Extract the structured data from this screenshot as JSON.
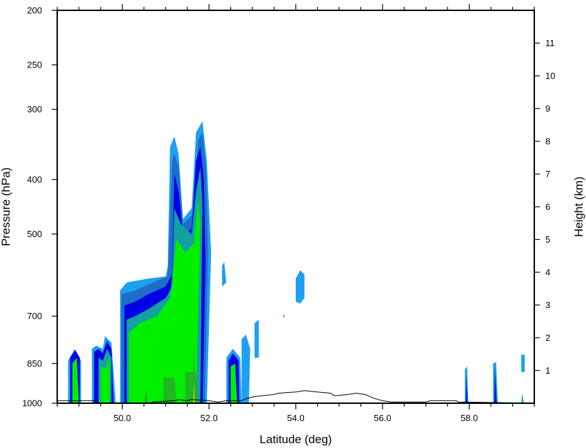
{
  "chart_data": {
    "type": "heatmap",
    "title": "",
    "xlabel": "Latitude (deg)",
    "ylabel": "Pressure (hPa)",
    "y2label": "Height (km)",
    "xlim": [
      48.5,
      59.5
    ],
    "ylim": [
      1000,
      200
    ],
    "y_scale": "log",
    "y2lim": [
      0,
      12
    ],
    "x_ticks": [
      50,
      52,
      54,
      56,
      58
    ],
    "x_tick_labels": [
      "50.0",
      "52.0",
      "54.0",
      "56.0",
      "58.0"
    ],
    "y_ticks": [
      200,
      250,
      300,
      400,
      500,
      700,
      850,
      1000
    ],
    "y_tick_labels": [
      "200",
      "250",
      "300",
      "400",
      "500",
      "700",
      "850",
      "1000"
    ],
    "y2_ticks": [
      1,
      2,
      3,
      4,
      5,
      6,
      7,
      8,
      9,
      10,
      11
    ],
    "y2_tick_labels": [
      "1",
      "2",
      "3",
      "4",
      "5",
      "6",
      "7",
      "8",
      "9",
      "10",
      "11"
    ],
    "grid": false,
    "colors": {
      "level1": "#1ea0f0",
      "level2": "#1e6ec8",
      "level3": "#0000e6",
      "level4": "#14a0a0",
      "level5": "#00f000",
      "level6": "#22b422",
      "level7": "#dcdc28"
    },
    "regions": [
      {
        "level": 1,
        "points": [
          [
            48.75,
            1000
          ],
          [
            48.75,
            840
          ],
          [
            48.9,
            800
          ],
          [
            49.05,
            840
          ],
          [
            49.05,
            1000
          ]
        ]
      },
      {
        "level": 3,
        "points": [
          [
            48.8,
            1000
          ],
          [
            48.8,
            830
          ],
          [
            48.92,
            805
          ],
          [
            49.02,
            830
          ],
          [
            49.02,
            1000
          ]
        ]
      },
      {
        "level": 5,
        "points": [
          [
            48.85,
            1000
          ],
          [
            48.85,
            850
          ],
          [
            48.95,
            830
          ],
          [
            49.0,
            1000
          ]
        ]
      },
      {
        "level": 1,
        "points": [
          [
            49.3,
            1000
          ],
          [
            49.3,
            800
          ],
          [
            49.4,
            790
          ],
          [
            49.55,
            800
          ],
          [
            49.6,
            760
          ],
          [
            49.75,
            780
          ],
          [
            49.85,
            1000
          ]
        ]
      },
      {
        "level": 3,
        "points": [
          [
            49.35,
            1000
          ],
          [
            49.35,
            810
          ],
          [
            49.45,
            800
          ],
          [
            49.55,
            815
          ],
          [
            49.65,
            775
          ],
          [
            49.75,
            800
          ],
          [
            49.8,
            1000
          ]
        ]
      },
      {
        "level": 4,
        "points": [
          [
            49.45,
            1000
          ],
          [
            49.45,
            830
          ],
          [
            49.55,
            840
          ],
          [
            49.65,
            800
          ],
          [
            49.75,
            830
          ],
          [
            49.75,
            1000
          ]
        ]
      },
      {
        "level": 5,
        "points": [
          [
            49.5,
            1000
          ],
          [
            49.5,
            860
          ],
          [
            49.6,
            870
          ],
          [
            49.7,
            830
          ],
          [
            49.72,
            1000
          ]
        ]
      },
      {
        "level": 1,
        "points": [
          [
            49.95,
            1000
          ],
          [
            49.95,
            630
          ],
          [
            50.1,
            610
          ],
          [
            50.6,
            600
          ],
          [
            51.0,
            595
          ],
          [
            51.05,
            570
          ],
          [
            51.1,
            350
          ],
          [
            51.2,
            335
          ],
          [
            51.3,
            360
          ],
          [
            51.4,
            470
          ],
          [
            51.6,
            450
          ],
          [
            51.7,
            330
          ],
          [
            51.85,
            315
          ],
          [
            51.95,
            370
          ],
          [
            52.05,
            540
          ],
          [
            51.95,
            1000
          ]
        ]
      },
      {
        "level": 2,
        "points": [
          [
            49.98,
            1000
          ],
          [
            49.98,
            640
          ],
          [
            50.3,
            630
          ],
          [
            50.7,
            610
          ],
          [
            51.05,
            595
          ],
          [
            51.15,
            370
          ],
          [
            51.2,
            360
          ],
          [
            51.3,
            380
          ],
          [
            51.4,
            480
          ],
          [
            51.65,
            460
          ],
          [
            51.75,
            340
          ],
          [
            51.85,
            330
          ],
          [
            51.93,
            380
          ],
          [
            51.98,
            540
          ],
          [
            51.9,
            1000
          ]
        ]
      },
      {
        "level": 3,
        "points": [
          [
            50.05,
            1000
          ],
          [
            50.05,
            670
          ],
          [
            50.3,
            660
          ],
          [
            50.6,
            640
          ],
          [
            51.0,
            620
          ],
          [
            51.15,
            590
          ],
          [
            51.2,
            390
          ],
          [
            51.3,
            420
          ],
          [
            51.4,
            500
          ],
          [
            51.6,
            490
          ],
          [
            51.7,
            370
          ],
          [
            51.8,
            350
          ],
          [
            51.88,
            400
          ],
          [
            51.92,
            560
          ],
          [
            51.85,
            1000
          ]
        ]
      },
      {
        "level": 4,
        "points": [
          [
            50.1,
            1000
          ],
          [
            50.1,
            710
          ],
          [
            50.3,
            700
          ],
          [
            50.6,
            680
          ],
          [
            51.0,
            650
          ],
          [
            51.15,
            620
          ],
          [
            51.2,
            450
          ],
          [
            51.35,
            480
          ],
          [
            51.6,
            500
          ],
          [
            51.7,
            420
          ],
          [
            51.8,
            380
          ],
          [
            51.85,
            440
          ],
          [
            51.8,
            1000
          ]
        ]
      },
      {
        "level": 5,
        "points": [
          [
            50.15,
            1000
          ],
          [
            50.15,
            750
          ],
          [
            50.4,
            720
          ],
          [
            50.8,
            700
          ],
          [
            51.1,
            650
          ],
          [
            51.25,
            510
          ],
          [
            51.45,
            540
          ],
          [
            51.65,
            520
          ],
          [
            51.75,
            430
          ],
          [
            51.8,
            480
          ],
          [
            51.78,
            580
          ],
          [
            51.7,
            1000
          ]
        ]
      },
      {
        "level": 6,
        "points": [
          [
            50.5,
            1000
          ],
          [
            50.55,
            950
          ],
          [
            50.6,
            1000
          ]
        ]
      },
      {
        "level": 6,
        "points": [
          [
            50.95,
            1000
          ],
          [
            50.95,
            900
          ],
          [
            51.2,
            900
          ],
          [
            51.25,
            1000
          ]
        ]
      },
      {
        "level": 6,
        "points": [
          [
            51.45,
            1000
          ],
          [
            51.45,
            880
          ],
          [
            51.7,
            880
          ],
          [
            51.75,
            1000
          ]
        ]
      },
      {
        "level": 6,
        "points": [
          [
            51.62,
            1000
          ],
          [
            51.65,
            760
          ],
          [
            51.68,
            1000
          ]
        ]
      },
      {
        "level": 7,
        "points": [
          [
            51.64,
            1000
          ],
          [
            51.65,
            910
          ],
          [
            51.67,
            1000
          ]
        ]
      },
      {
        "level": 1,
        "points": [
          [
            52.4,
            1000
          ],
          [
            52.4,
            830
          ],
          [
            52.55,
            800
          ],
          [
            52.72,
            830
          ],
          [
            52.75,
            1000
          ]
        ]
      },
      {
        "level": 3,
        "points": [
          [
            52.45,
            1000
          ],
          [
            52.45,
            840
          ],
          [
            52.55,
            815
          ],
          [
            52.68,
            840
          ],
          [
            52.7,
            1000
          ]
        ]
      },
      {
        "level": 5,
        "points": [
          [
            52.5,
            1000
          ],
          [
            52.5,
            860
          ],
          [
            52.6,
            850
          ],
          [
            52.65,
            1000
          ]
        ]
      },
      {
        "level": 1,
        "points": [
          [
            52.75,
            1000
          ],
          [
            52.75,
            770
          ],
          [
            52.85,
            755
          ],
          [
            52.95,
            800
          ],
          [
            52.92,
            1000
          ]
        ]
      },
      {
        "level": 1,
        "points": [
          [
            53.05,
            830
          ],
          [
            53.05,
            720
          ],
          [
            53.15,
            710
          ],
          [
            53.15,
            830
          ]
        ]
      },
      {
        "level": 1,
        "points": [
          [
            53.7,
            695
          ],
          [
            53.75,
            700
          ],
          [
            53.72,
            705
          ]
        ]
      },
      {
        "level": 1,
        "points": [
          [
            54.0,
            660
          ],
          [
            54.0,
            600
          ],
          [
            54.1,
            580
          ],
          [
            54.2,
            590
          ],
          [
            54.2,
            650
          ],
          [
            54.1,
            665
          ]
        ]
      },
      {
        "level": 1,
        "points": [
          [
            52.3,
            620
          ],
          [
            52.3,
            570
          ],
          [
            52.35,
            560
          ],
          [
            52.4,
            610
          ]
        ]
      },
      {
        "level": 1,
        "points": [
          [
            57.9,
            1000
          ],
          [
            57.9,
            870
          ],
          [
            57.95,
            860
          ],
          [
            57.98,
            1000
          ]
        ]
      },
      {
        "level": 3,
        "points": [
          [
            57.92,
            1000
          ],
          [
            57.93,
            890
          ],
          [
            57.96,
            1000
          ]
        ]
      },
      {
        "level": 1,
        "points": [
          [
            58.55,
            1000
          ],
          [
            58.55,
            850
          ],
          [
            58.62,
            845
          ],
          [
            58.66,
            1000
          ]
        ]
      },
      {
        "level": 3,
        "points": [
          [
            58.58,
            1000
          ],
          [
            58.59,
            860
          ],
          [
            58.63,
            1000
          ]
        ]
      },
      {
        "level": 1,
        "points": [
          [
            59.2,
            880
          ],
          [
            59.2,
            820
          ],
          [
            59.28,
            820
          ],
          [
            59.28,
            880
          ]
        ]
      },
      {
        "level": 1,
        "points": [
          [
            59.2,
            1000
          ],
          [
            59.22,
            960
          ],
          [
            59.26,
            1000
          ]
        ]
      }
    ],
    "terrain": [
      [
        48.5,
        1000
      ],
      [
        48.5,
        990
      ],
      [
        49.4,
        990
      ],
      [
        49.45,
        1000
      ],
      [
        50.65,
        1000
      ],
      [
        50.7,
        995
      ],
      [
        51.2,
        990
      ],
      [
        51.3,
        985
      ],
      [
        51.5,
        990
      ],
      [
        51.6,
        985
      ],
      [
        52.0,
        990
      ],
      [
        52.2,
        995
      ],
      [
        52.4,
        990
      ],
      [
        52.75,
        990
      ],
      [
        52.8,
        985
      ],
      [
        53.0,
        975
      ],
      [
        53.2,
        970
      ],
      [
        53.5,
        965
      ],
      [
        53.6,
        960
      ],
      [
        54.0,
        955
      ],
      [
        54.2,
        950
      ],
      [
        54.5,
        955
      ],
      [
        54.8,
        960
      ],
      [
        54.9,
        970
      ],
      [
        55.2,
        965
      ],
      [
        55.4,
        960
      ],
      [
        55.6,
        965
      ],
      [
        55.8,
        980
      ],
      [
        56.0,
        990
      ],
      [
        56.2,
        995
      ],
      [
        57.0,
        995
      ],
      [
        57.1,
        990
      ],
      [
        57.7,
        990
      ],
      [
        57.75,
        995
      ],
      [
        59.5,
        1000
      ]
    ]
  }
}
